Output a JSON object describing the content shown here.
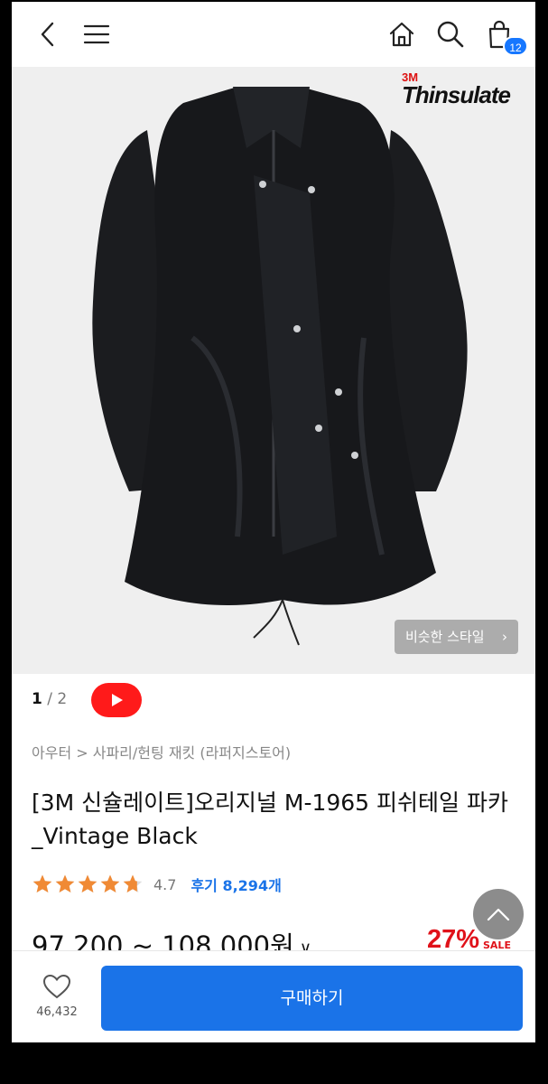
{
  "header": {
    "back_icon": "chevron-left-icon",
    "menu_icon": "hamburger-menu-icon",
    "home_icon": "home-icon",
    "search_icon": "search-icon",
    "cart_icon": "shopping-bag-icon",
    "cart_count": "12"
  },
  "gallery": {
    "brand_mark": "3M",
    "brand_name": "Thinsulate",
    "similar_style_label": "비슷한 스타일",
    "current_page": "1",
    "total_pages": "/ 2"
  },
  "product": {
    "breadcrumb": "아우터 > 사파리/헌팅 재킷 (라퍼지스토어)",
    "title_line1": "[3M 신슐레이트]오리지널 M-1965 피쉬테일 파카",
    "title_line2": "_Vintage Black",
    "rating_value": 4.7,
    "rating_text": "4.7",
    "reviews_label": "후기 8,294개",
    "price_range": "97,200 ~ 108,000원",
    "discount": "27%",
    "discount_label": "SALE"
  },
  "bottom_bar": {
    "like_count": "46,432",
    "buy_label": "구매하기"
  },
  "colors": {
    "accent": "#1a73e8",
    "sale": "#e0121a",
    "star": "#f08a35",
    "youtube": "#ff1a1a"
  }
}
